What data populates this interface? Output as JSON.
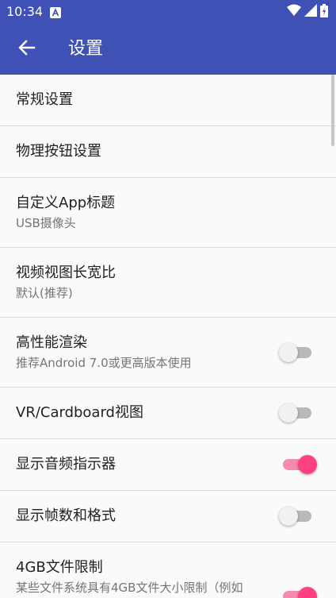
{
  "status_bar": {
    "time": "10:34",
    "icons": [
      "notification-a-icon",
      "wifi-icon",
      "signal-icon",
      "battery-icon"
    ]
  },
  "app_bar": {
    "title": "设置",
    "back_icon": "arrow-back-icon",
    "color": "#3f51b5"
  },
  "accent_color": "#ff4081",
  "settings": [
    {
      "title": "常规设置"
    },
    {
      "title": "物理按钮设置"
    },
    {
      "title": "自定义App标题",
      "summary": "USB摄像头"
    },
    {
      "title": "视频视图长宽比",
      "summary": "默认(推荐)"
    },
    {
      "title": "高性能渲染",
      "summary": "推荐Android 7.0或更高版本使用",
      "toggle": false
    },
    {
      "title": "VR/Cardboard视图",
      "toggle": false
    },
    {
      "title": "显示音频指示器",
      "toggle": true
    },
    {
      "title": "显示帧数和格式",
      "toggle": false
    },
    {
      "title": "4GB文件限制",
      "summary": "某些文件系统具有4GB文件大小限制（例如",
      "toggle": true
    }
  ]
}
